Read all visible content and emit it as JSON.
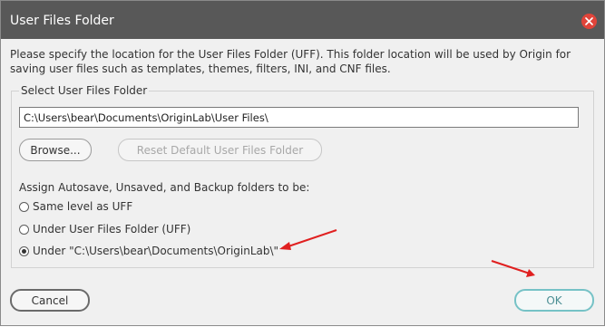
{
  "dialog": {
    "title": "User Files Folder",
    "description": "Please specify the location for the User Files Folder (UFF). This folder location will be used by Origin for saving user files such as templates, themes, filters, INI, and CNF files.",
    "close_icon": "close-icon"
  },
  "uff_group": {
    "label": "Select User Files Folder",
    "path_value": "C:\\Users\\bear\\Documents\\OriginLab\\User Files\\",
    "browse_label": "Browse...",
    "reset_label": "Reset Default User Files Folder"
  },
  "assign": {
    "label": "Assign Autosave, Unsaved, and Backup folders to be:",
    "options": [
      {
        "label": "Same level as UFF",
        "checked": false
      },
      {
        "label": "Under User Files Folder (UFF)",
        "checked": false
      },
      {
        "label": "Under \"C:\\Users\\bear\\Documents\\OriginLab\\\"",
        "checked": true
      }
    ]
  },
  "footer": {
    "cancel_label": "Cancel",
    "ok_label": "OK"
  },
  "colors": {
    "titlebar": "#585858",
    "close": "#e0443a",
    "ok_border": "#76c2c6",
    "annotation_arrow": "#e02020"
  }
}
